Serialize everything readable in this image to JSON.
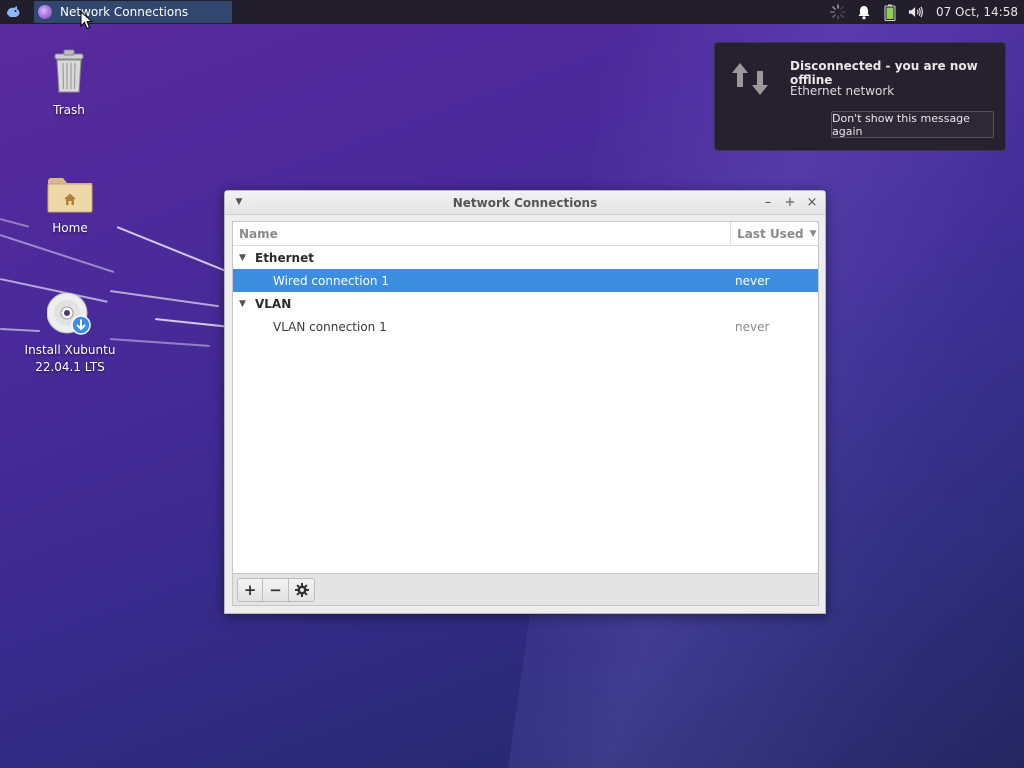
{
  "panel": {
    "menu_icon": "whisker-mouse-icon",
    "task": {
      "icon": "network-connections-app-icon",
      "label": "Network Connections"
    },
    "tray_icons": [
      "network-busy-icon",
      "notification-bell-icon",
      "battery-icon",
      "volume-icon"
    ],
    "clock": "07 Oct, 14:58"
  },
  "desktop": {
    "icons": [
      {
        "name": "trash",
        "icon": "trash-icon",
        "label": "Trash"
      },
      {
        "name": "home",
        "icon": "home-folder-icon",
        "label": "Home"
      },
      {
        "name": "install",
        "icon": "install-disc-icon",
        "label_line1": "Install Xubuntu",
        "label_line2": "22.04.1 LTS"
      }
    ]
  },
  "notification": {
    "icon": "network-transfer-icon",
    "title": "Disconnected - you are now offline",
    "body": "Ethernet network",
    "button": "Don't show this message again"
  },
  "window": {
    "title": "Network Connections",
    "controls": {
      "minimize": "–",
      "maximize": "+",
      "close": "×"
    },
    "columns": {
      "name": "Name",
      "last_used": "Last Used"
    },
    "groups": [
      {
        "label": "Ethernet",
        "connections": [
          {
            "name": "Wired connection 1",
            "last_used": "never",
            "selected": true
          }
        ]
      },
      {
        "label": "VLAN",
        "connections": [
          {
            "name": "VLAN connection 1",
            "last_used": "never",
            "selected": false
          }
        ]
      }
    ],
    "toolbar": {
      "add": "+",
      "remove": "−",
      "settings": "settings-gear-icon"
    }
  },
  "colors": {
    "selection": "#3d8ee0",
    "panel_bg": "#221e2c",
    "task_active": "#31476d"
  }
}
